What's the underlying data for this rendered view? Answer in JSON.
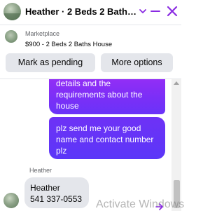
{
  "header": {
    "title": "Heather · 2 Beds 2 Baths H…",
    "accent_color": "#8a2be2",
    "icons": [
      "contact-avatar",
      "chevron-down-icon",
      "minimize-icon",
      "close-icon"
    ]
  },
  "listing": {
    "category": "Marketplace",
    "description": "$900 - 2 Beds 2 Baths House"
  },
  "actions": {
    "mark_pending": "Mark as pending",
    "more_options": "More options"
  },
  "messages": {
    "outgoing_1": "details and the requirements about the house",
    "outgoing_2": "plz send me your good name and contact number plz",
    "incoming_sender": "Heather",
    "incoming_line1": "Heather",
    "incoming_line2": "541 337-0553"
  },
  "colors": {
    "outgoing_bubble": "#7b2ff7",
    "incoming_bubble": "#e4e6eb"
  },
  "watermark": "Activate Windows"
}
